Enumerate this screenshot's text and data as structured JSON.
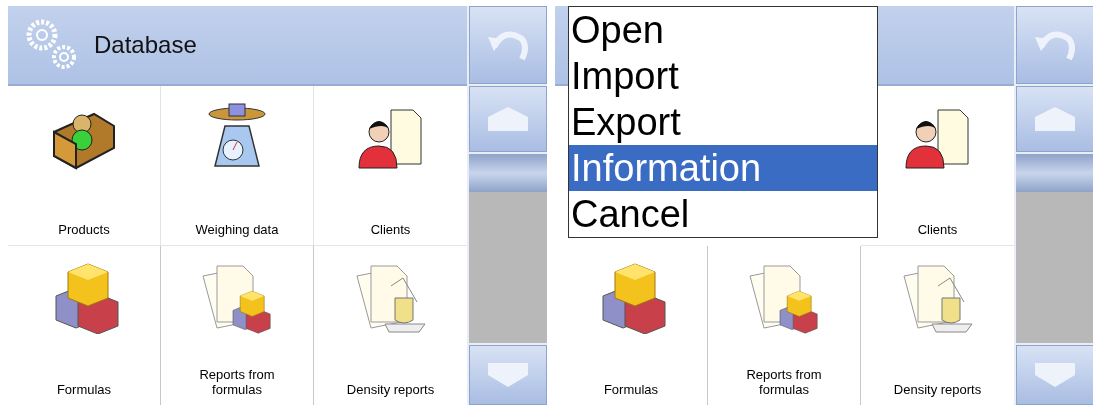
{
  "screens": [
    {
      "title": "Database",
      "tiles": [
        {
          "kind": "products",
          "label": "Products"
        },
        {
          "kind": "weighing",
          "label": "Weighing data"
        },
        {
          "kind": "clients",
          "label": "Clients"
        },
        {
          "kind": "formulas",
          "label": "Formulas"
        },
        {
          "kind": "reports",
          "label": "Reports from formulas"
        },
        {
          "kind": "density",
          "label": "Density reports"
        }
      ]
    },
    {
      "menu": [
        {
          "label": "Open",
          "selected": false
        },
        {
          "label": "Import",
          "selected": false
        },
        {
          "label": "Export",
          "selected": false
        },
        {
          "label": "Information",
          "selected": true
        },
        {
          "label": "Cancel",
          "selected": false
        }
      ],
      "tiles": [
        {
          "kind": "clients",
          "label": "Clients"
        },
        {
          "kind": "formulas",
          "label": "Formulas"
        },
        {
          "kind": "reports",
          "label": "Reports from formulas"
        },
        {
          "kind": "density",
          "label": "Density reports"
        }
      ]
    }
  ]
}
